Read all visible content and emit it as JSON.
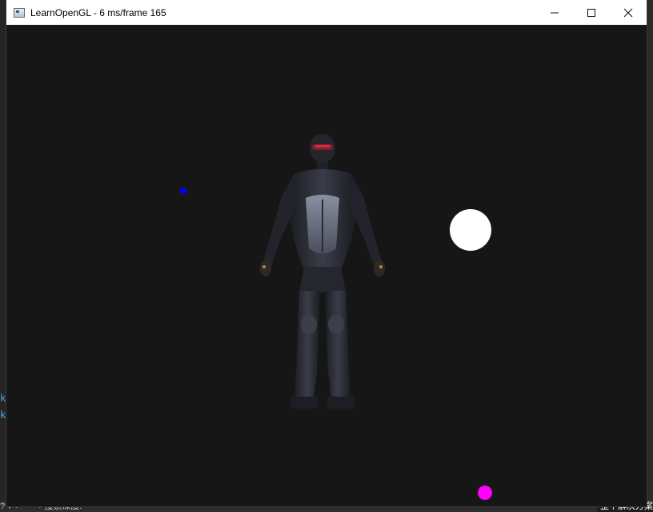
{
  "window": {
    "title": "LearnOpenGL - 6 ms/frame 165",
    "controls": {
      "minimize_icon": "minimize-icon",
      "maximize_icon": "maximize-icon",
      "close_icon": "close-icon"
    }
  },
  "scene": {
    "background_color": "#161616",
    "lights": [
      {
        "name": "blue-light",
        "color": "#0000ff"
      },
      {
        "name": "white-light",
        "color": "#ffffff"
      },
      {
        "name": "magenta-light",
        "color": "#ff00ff"
      }
    ],
    "model": "nanosuit-model"
  },
  "background_ide": {
    "left_fragments": [
      "k",
      "k"
    ],
    "bottom_left_text": "? ▾  ⟵ ⟶  搜索深度:",
    "bottom_right_text": "整个解决方案"
  }
}
